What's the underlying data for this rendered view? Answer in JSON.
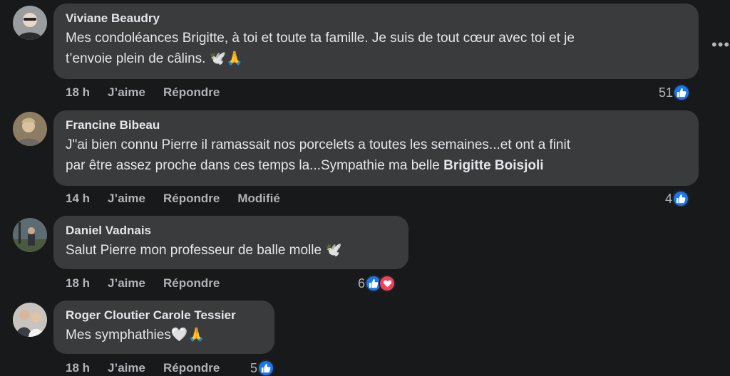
{
  "comments": [
    {
      "author": "Viviane Beaudry",
      "text_line1": "Mes condoléances Brigitte, à toi et toute ta famille. Je suis de tout cœur avec toi et je",
      "text_line2": "t’envoie plein de câlins. 🕊️🙏",
      "time": "18 h",
      "like_label": "J’aime",
      "reply_label": "Répondre",
      "reaction_count": "51",
      "reactions": [
        "like-icon"
      ]
    },
    {
      "author": "Francine Bibeau",
      "text_line1": "J\"ai bien connu Pierre il ramassait nos porcelets a toutes les semaines...et ont a finit",
      "text_line2_prefix": "par être assez proche dans ces temps la...Sympathie ma belle ",
      "mention": "Brigitte Boisjoli",
      "time": "14 h",
      "like_label": "J’aime",
      "reply_label": "Répondre",
      "edited_label": "Modifié",
      "reaction_count": "4",
      "reactions": [
        "like-icon"
      ]
    },
    {
      "author": "Daniel Vadnais",
      "text_line1": "Salut Pierre mon professeur de balle molle 🕊️",
      "time": "18 h",
      "like_label": "J’aime",
      "reply_label": "Répondre",
      "reaction_count": "6",
      "reactions": [
        "like-icon",
        "love-icon"
      ]
    },
    {
      "author": "Roger Cloutier Carole Tessier",
      "text_line1": "Mes symphathies🤍🙏",
      "time": "18 h",
      "like_label": "J’aime",
      "reply_label": "Répondre",
      "reaction_count": "5",
      "reactions": [
        "like-icon"
      ]
    }
  ],
  "more_options_icon": "more-horizontal-icon",
  "colors": {
    "background": "#18191a",
    "bubble": "#3a3b3c",
    "primary_text": "#e4e6eb",
    "secondary_text": "#b0b3b8",
    "like_blue": "#1877f2",
    "love_red": "#f33e58"
  }
}
